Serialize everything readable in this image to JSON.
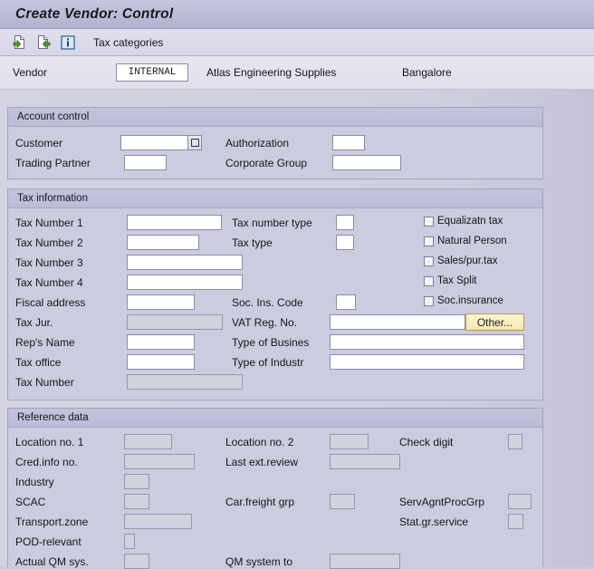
{
  "window": {
    "title": "Create Vendor: Control"
  },
  "toolbar": {
    "icons": [
      {
        "name": "create-document-icon",
        "glyph": "doc-green-left"
      },
      {
        "name": "copy-document-icon",
        "glyph": "doc-green-right"
      },
      {
        "name": "info-icon",
        "glyph": "info-blue"
      }
    ],
    "tax_categories_label": "Tax categories"
  },
  "vendor_header": {
    "label": "Vendor",
    "value": "INTERNAL",
    "name": "Atlas Engineering Supplies",
    "city": "Bangalore"
  },
  "account_control": {
    "title": "Account control",
    "fields": [
      {
        "label": "Customer",
        "value": "",
        "disabled": false,
        "lookup": true
      },
      {
        "label": "Authorization",
        "value": "",
        "disabled": false,
        "lookup": false
      },
      {
        "label": "Trading Partner",
        "value": "",
        "disabled": false,
        "lookup": false
      },
      {
        "label": "Corporate Group",
        "value": "",
        "disabled": false,
        "lookup": false
      }
    ]
  },
  "tax_information": {
    "title": "Tax information",
    "fields": [
      {
        "label": "Tax Number 1",
        "value": "",
        "disabled": false
      },
      {
        "label": "Tax number type",
        "value": "",
        "disabled": false
      },
      {
        "label": "Tax Number 2",
        "value": "",
        "disabled": false
      },
      {
        "label": "Tax type",
        "value": "",
        "disabled": false
      },
      {
        "label": "Tax Number 3",
        "value": "",
        "disabled": false
      },
      {
        "label": "Tax Number 4",
        "value": "",
        "disabled": false
      },
      {
        "label": "Fiscal address",
        "value": "",
        "disabled": false
      },
      {
        "label": "Soc. Ins. Code",
        "value": "",
        "disabled": false
      },
      {
        "label": "Tax Jur.",
        "value": "",
        "disabled": true
      },
      {
        "label": "VAT Reg. No.",
        "value": "",
        "disabled": false
      },
      {
        "label": "Rep's Name",
        "value": "",
        "disabled": false
      },
      {
        "label": "Type of Busines",
        "value": "",
        "disabled": false
      },
      {
        "label": "Tax office",
        "value": "",
        "disabled": false
      },
      {
        "label": "Type of Industr",
        "value": "",
        "disabled": false
      },
      {
        "label": "Tax Number",
        "value": "",
        "disabled": true
      }
    ],
    "checkboxes": [
      {
        "label": "Equalizatn tax",
        "checked": false
      },
      {
        "label": "Natural Person",
        "checked": false
      },
      {
        "label": "Sales/pur.tax",
        "checked": false
      },
      {
        "label": "Tax Split",
        "checked": false
      },
      {
        "label": "Soc.insurance",
        "checked": false
      }
    ],
    "other_button_label": "Other..."
  },
  "reference_data": {
    "title": "Reference data",
    "fields": [
      {
        "label": "Location no. 1",
        "value": "",
        "disabled": true
      },
      {
        "label": "Location no. 2",
        "value": "",
        "disabled": true
      },
      {
        "label": "Check digit",
        "value": "",
        "disabled": true
      },
      {
        "label": "Cred.info no.",
        "value": "",
        "disabled": true
      },
      {
        "label": "Last ext.review",
        "value": "",
        "disabled": true
      },
      {
        "label": "Industry",
        "value": "",
        "disabled": true
      },
      {
        "label": "SCAC",
        "value": "",
        "disabled": true
      },
      {
        "label": "Car.freight grp",
        "value": "",
        "disabled": true
      },
      {
        "label": "ServAgntProcGrp",
        "value": "",
        "disabled": true
      },
      {
        "label": "Transport.zone",
        "value": "",
        "disabled": true
      },
      {
        "label": "Stat.gr.service",
        "value": "",
        "disabled": true
      },
      {
        "label": "POD-relevant",
        "value": "",
        "disabled": true
      },
      {
        "label": "Actual QM sys.",
        "value": "",
        "disabled": true
      },
      {
        "label": "QM system to",
        "value": "",
        "disabled": true
      }
    ]
  },
  "colors": {
    "titlebar": "#bcbcd8",
    "panel_bg": "#ccccdf",
    "panel_head": "#c0c0da",
    "field_bg": "#ffffff",
    "field_disabled": "#d2d2de",
    "other_button": "#f6e9b4",
    "accent_border": "#a3a3c0"
  }
}
